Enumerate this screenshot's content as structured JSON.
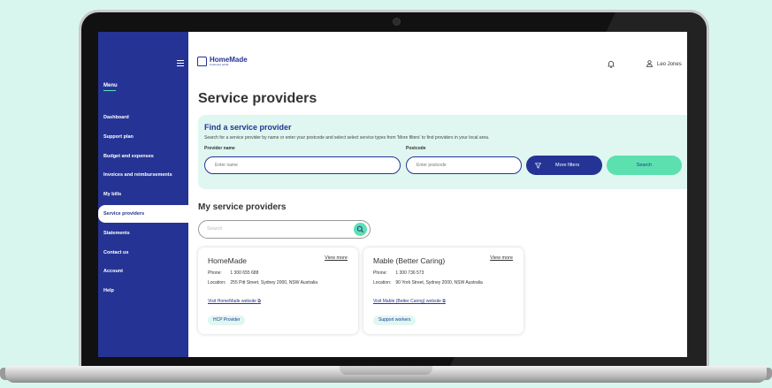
{
  "sidebar": {
    "menu_label": "Menu",
    "items": [
      {
        "label": "Dashboard"
      },
      {
        "label": "Support plan"
      },
      {
        "label": "Budget and expenses"
      },
      {
        "label": "Invoices and reimbursements"
      },
      {
        "label": "My bills"
      },
      {
        "label": "Service providers",
        "active": true
      },
      {
        "label": "Statements"
      },
      {
        "label": "Contact us"
      },
      {
        "label": "Account"
      },
      {
        "label": "Help"
      }
    ]
  },
  "header": {
    "logo_text": "HomeMade",
    "logo_sub": "Customer portal",
    "user_name": "Leo Jones"
  },
  "page": {
    "title": "Service providers"
  },
  "find": {
    "title": "Find a service provider",
    "description": "Search for a service provider by name or enter your postcode and select select service types from 'More filters' to find providers in your local area.",
    "provider_label": "Provider name",
    "provider_placeholder": "Enter name",
    "postcode_label": "Postcode",
    "postcode_placeholder": "Enter postcode",
    "filters_label": "More filters",
    "search_label": "Search"
  },
  "my_providers": {
    "title": "My service providers",
    "search_placeholder": "Search",
    "cards": [
      {
        "name": "HomeMade",
        "view_more": "View more",
        "phone_label": "Phone:",
        "phone": "1 300 655 688",
        "location_label": "Location:",
        "location": "255 Pitt Street, Sydney 2000, NSW Australia",
        "website": "Visit HomeMade website",
        "tag": "HCP Provider"
      },
      {
        "name": "Mable (Better Caring)",
        "view_more": "View more",
        "phone_label": "Phone:",
        "phone": "1 300 736 573",
        "location_label": "Location:",
        "location": "90 York Street, Sydney 2000, NSW Australia",
        "website": "Visit Mable (Better Caring) website",
        "tag": "Support workers"
      }
    ]
  },
  "colors": {
    "brand": "#253494",
    "accent": "#5ce0b0",
    "panel": "#e0f7f1",
    "background": "#d9f6ee"
  }
}
